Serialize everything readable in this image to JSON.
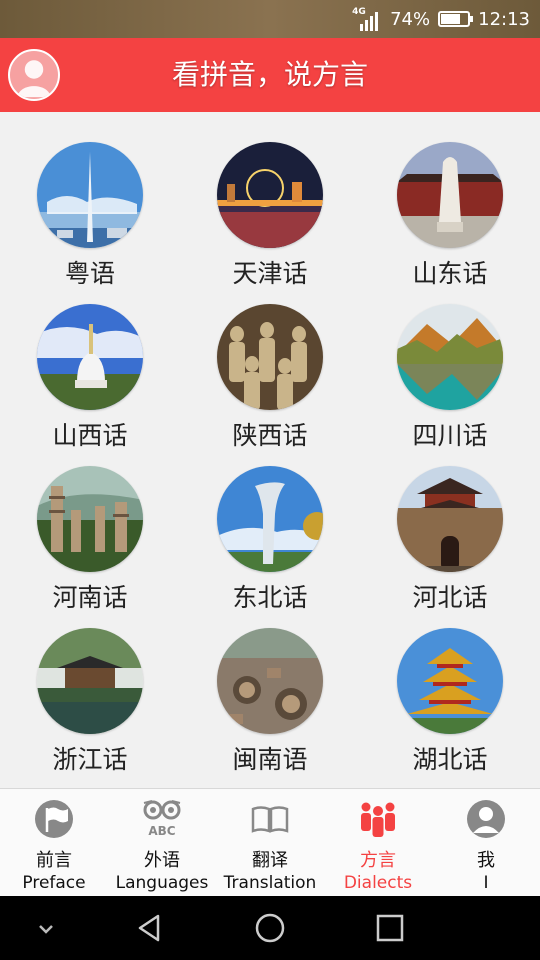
{
  "status_bar": {
    "network": "4G",
    "battery": "74%",
    "battery_level": 0.74,
    "time": "12:13"
  },
  "header": {
    "title": "看拼音，说方言",
    "avatar_icon": "user-avatar-icon",
    "color": "#f44242"
  },
  "dialects": [
    {
      "label": "粤语",
      "image": "canton-tower-image"
    },
    {
      "label": "天津话",
      "image": "tianjin-eye-image"
    },
    {
      "label": "山东话",
      "image": "confucius-statue-image"
    },
    {
      "label": "山西话",
      "image": "white-pagoda-image"
    },
    {
      "label": "陕西话",
      "image": "terracotta-warriors-image"
    },
    {
      "label": "四川话",
      "image": "jiuzhaigou-lake-image"
    },
    {
      "label": "河南话",
      "image": "shaolin-pagoda-forest-image"
    },
    {
      "label": "东北话",
      "image": "modern-tower-image"
    },
    {
      "label": "河北话",
      "image": "city-wall-gate-image"
    },
    {
      "label": "浙江话",
      "image": "west-lake-pavilion-image"
    },
    {
      "label": "闽南语",
      "image": "tulou-village-image"
    },
    {
      "label": "湖北话",
      "image": "yellow-crane-tower-image"
    }
  ],
  "tabs": [
    {
      "zh": "前言",
      "en": "Preface",
      "icon": "flag-icon",
      "active": false
    },
    {
      "zh": "外语",
      "en": "Languages",
      "icon": "abc-owl-icon",
      "active": false
    },
    {
      "zh": "翻译",
      "en": "Translation",
      "icon": "book-icon",
      "active": false
    },
    {
      "zh": "方言",
      "en": "Dialects",
      "icon": "people-group-icon",
      "active": true
    },
    {
      "zh": "我",
      "en": "I",
      "icon": "user-icon",
      "active": false
    }
  ],
  "active_color": "#f44242",
  "nav": {
    "icons": [
      "down-chevron-icon",
      "back-triangle-icon",
      "home-circle-icon",
      "recents-square-icon"
    ]
  }
}
